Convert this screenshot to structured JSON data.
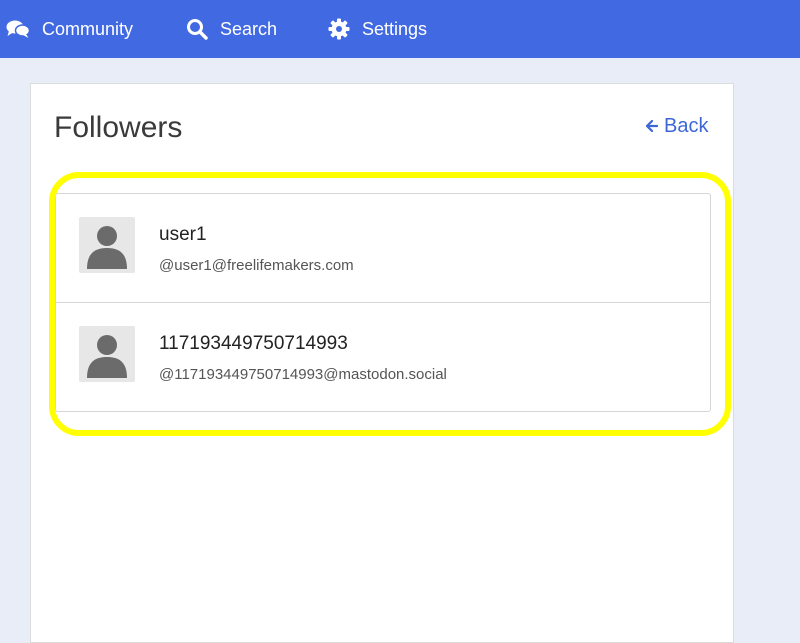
{
  "navbar": {
    "background": "#4169e1",
    "items": [
      {
        "label": "Community",
        "icon": "comments-icon"
      },
      {
        "label": "Search",
        "icon": "search-icon"
      },
      {
        "label": "Settings",
        "icon": "gear-icon"
      }
    ]
  },
  "page": {
    "title": "Followers",
    "back_label": "Back",
    "back_icon": "arrow-left-icon",
    "highlight_color": "#ffff00"
  },
  "followers": [
    {
      "name": "user1",
      "handle": "@user1@freelifemakers.com",
      "avatar": "default-avatar-icon"
    },
    {
      "name": "117193449750714993",
      "handle": "@117193449750714993@mastodon.social",
      "avatar": "default-avatar-icon"
    }
  ]
}
